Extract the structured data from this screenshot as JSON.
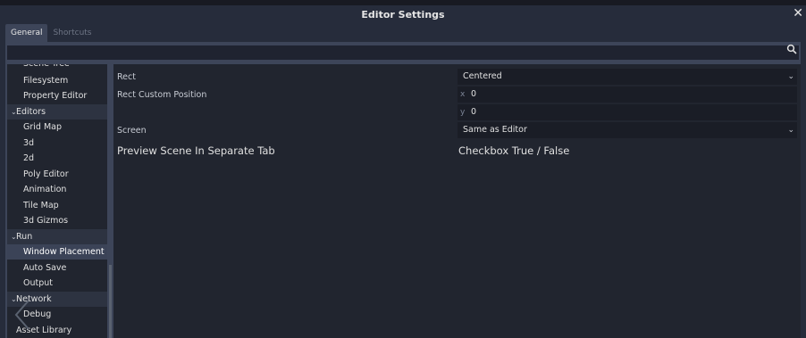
{
  "window": {
    "title": "Editor Settings"
  },
  "tabs": [
    {
      "label": "General",
      "active": true
    },
    {
      "label": "Shortcuts",
      "active": false
    }
  ],
  "search": {
    "value": "",
    "placeholder": ""
  },
  "sidebar": {
    "items": [
      {
        "label": "Scene Tree",
        "type": "sub"
      },
      {
        "label": "Filesystem",
        "type": "sub"
      },
      {
        "label": "Property Editor",
        "type": "sub"
      },
      {
        "label": "Editors",
        "type": "category"
      },
      {
        "label": "Grid Map",
        "type": "sub"
      },
      {
        "label": "3d",
        "type": "sub"
      },
      {
        "label": "2d",
        "type": "sub"
      },
      {
        "label": "Poly Editor",
        "type": "sub"
      },
      {
        "label": "Animation",
        "type": "sub"
      },
      {
        "label": "Tile Map",
        "type": "sub"
      },
      {
        "label": "3d Gizmos",
        "type": "sub"
      },
      {
        "label": "Run",
        "type": "category"
      },
      {
        "label": "Window Placement",
        "type": "sub",
        "selected": true
      },
      {
        "label": "Auto Save",
        "type": "sub"
      },
      {
        "label": "Output",
        "type": "sub"
      },
      {
        "label": "Network",
        "type": "category"
      },
      {
        "label": "Debug",
        "type": "sub"
      },
      {
        "label": "Asset Library",
        "type": "top"
      }
    ]
  },
  "settings": {
    "rect": {
      "label": "Rect",
      "value": "Centered"
    },
    "rect_custom_position": {
      "label": "Rect Custom Position",
      "x_label": "x",
      "x_value": "0",
      "y_label": "y",
      "y_value": "0"
    },
    "screen": {
      "label": "Screen",
      "value": "Same as Editor"
    },
    "preview": {
      "label": "Preview Scene In Separate Tab",
      "value": "Checkbox True / False"
    }
  },
  "colors": {
    "accent": "#3d4559",
    "background": "#21252f"
  },
  "icons": {
    "close": "close-icon",
    "search": "search-icon",
    "dropdown": "chevron-down-icon",
    "expand": "caret-down-icon",
    "back": "chevron-left-icon"
  }
}
